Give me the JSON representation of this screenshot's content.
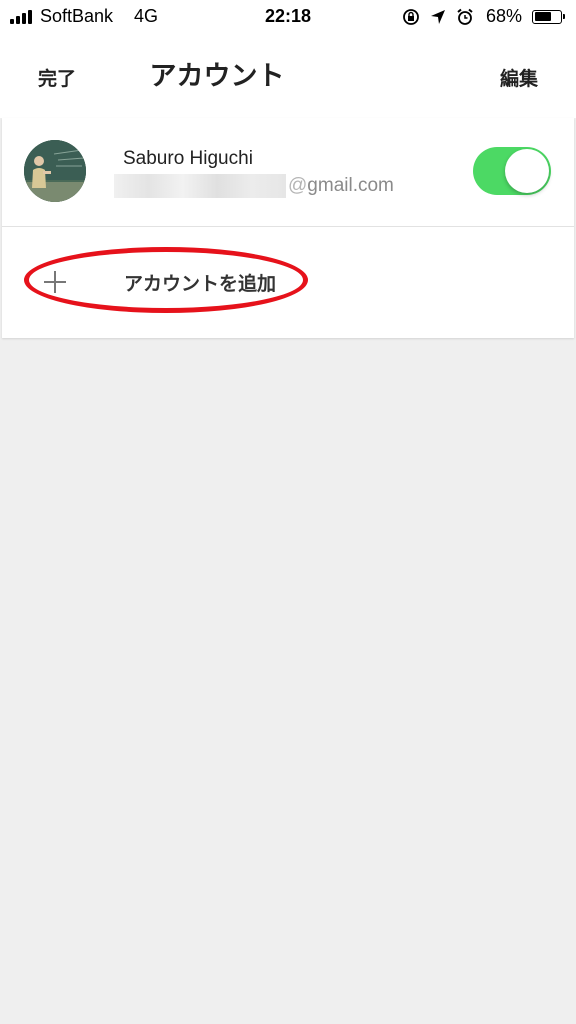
{
  "status_bar": {
    "carrier": "SoftBank",
    "network": "4G",
    "time": "22:18",
    "battery_percent": "68%",
    "battery_level": 0.68,
    "icons": [
      "signal-bars-icon",
      "orientation-lock-icon",
      "location-arrow-icon",
      "alarm-clock-icon",
      "battery-icon"
    ]
  },
  "nav": {
    "done_label": "完了",
    "title": "アカウント",
    "edit_label": "編集"
  },
  "account": {
    "name": "Saburo Higuchi",
    "email_visible": "gmail.com",
    "email_domain_prefix": "@",
    "enabled": true,
    "avatar_icon": "user-photo-avatar"
  },
  "add_account": {
    "label": "アカウントを追加",
    "icon": "plus-icon"
  },
  "colors": {
    "toggle_on": "#4cd964",
    "highlight": "#e6121b",
    "background": "#efefef"
  }
}
